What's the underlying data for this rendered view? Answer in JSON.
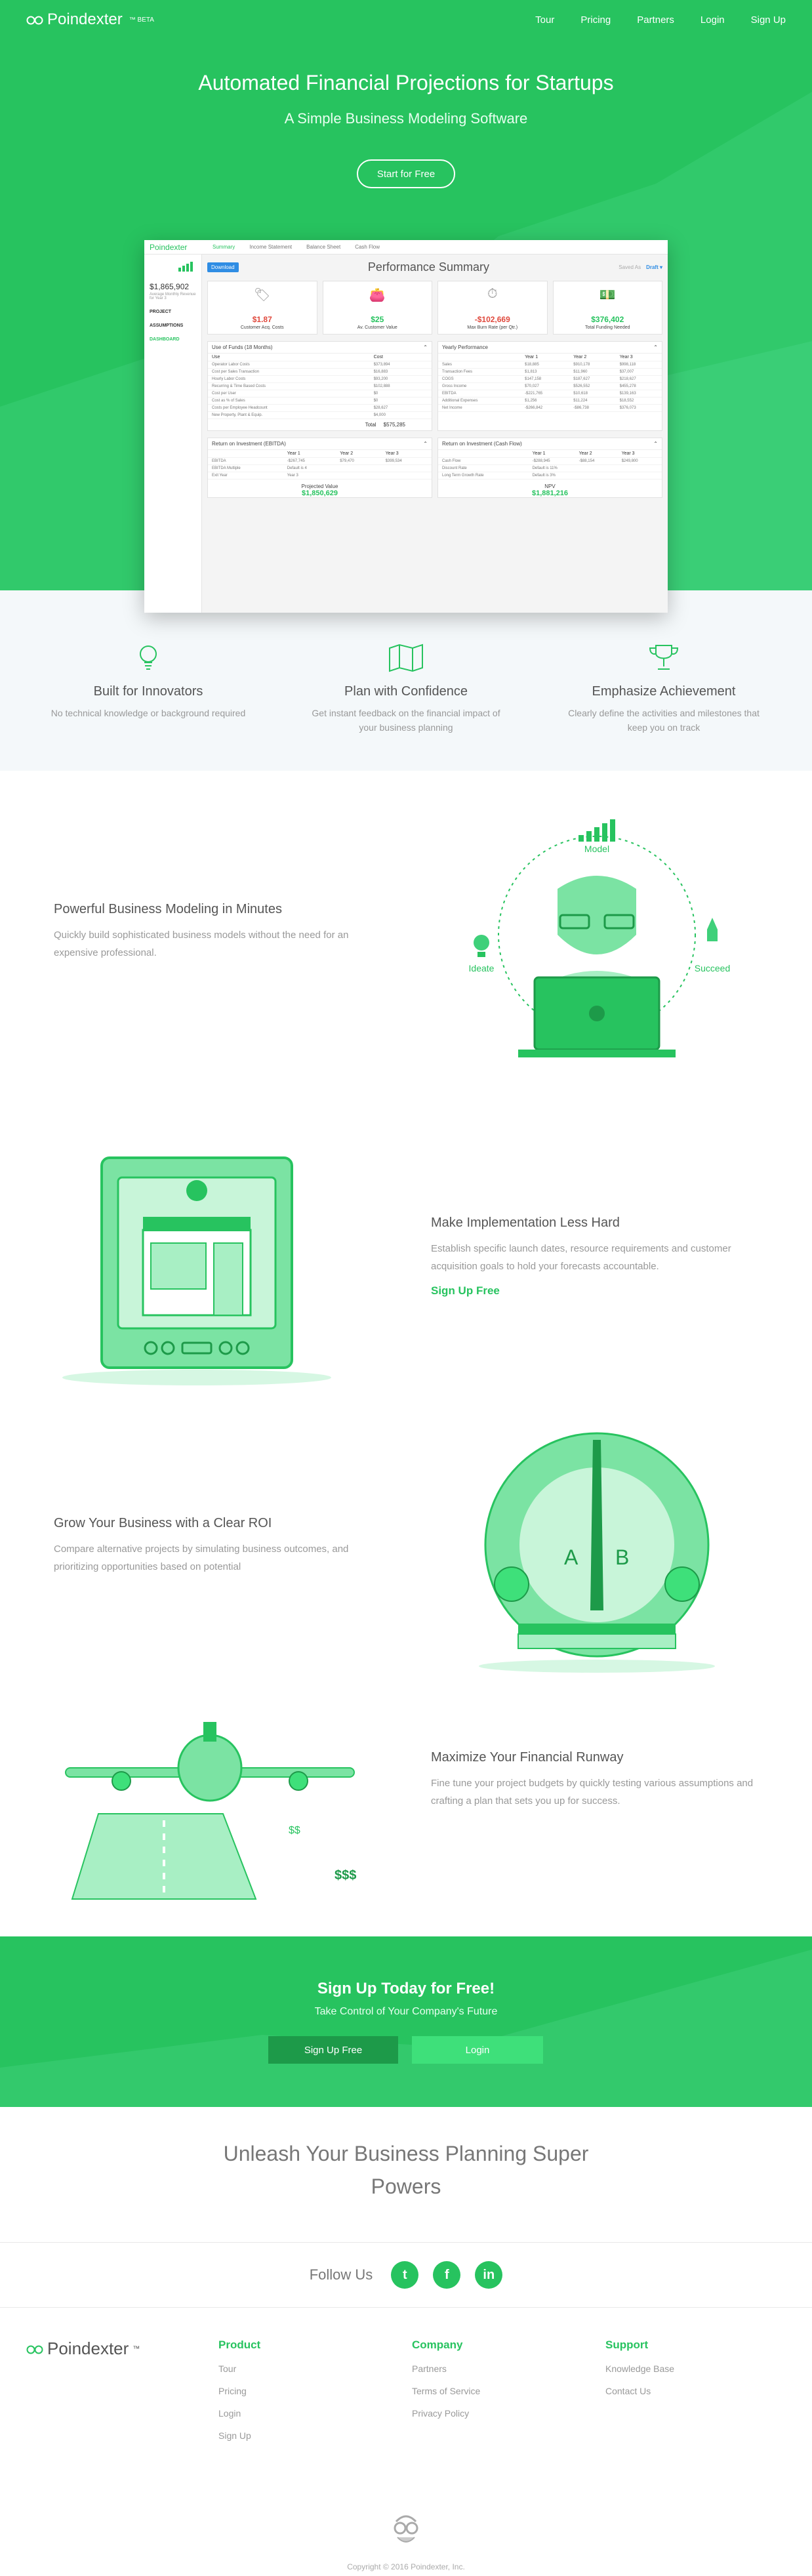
{
  "nav": {
    "brand": "Poindexter",
    "brand_tag": "™ BETA",
    "links": [
      "Tour",
      "Pricing",
      "Partners",
      "Login",
      "Sign Up"
    ]
  },
  "hero": {
    "title": "Automated Financial Projections for Startups",
    "subtitle": "A Simple Business Modeling Software",
    "cta": "Start for Free"
  },
  "app": {
    "logo": "Poindexter",
    "tabs": [
      "Summary",
      "Income Statement",
      "Balance Sheet",
      "Cash Flow"
    ],
    "side_value": "$1,865,902",
    "side_caption": "Average Monthly Revenue for Year 3",
    "side_links": [
      "PROJECT",
      "ASSUMPTIONS",
      "DASHBOARD"
    ],
    "download": "Download",
    "page_title": "Performance Summary",
    "saved_as": "Saved As",
    "draft": "Draft ▾",
    "cards": [
      {
        "value": "$1.87",
        "label": "Customer Acq. Costs",
        "color": "#e0493d",
        "icon": "tag-icon",
        "glyph": "🏷"
      },
      {
        "value": "$25",
        "label": "Av. Customer Value",
        "color": "#27c35f",
        "icon": "wallet-icon",
        "glyph": "👛"
      },
      {
        "value": "-$102,669",
        "label": "Max Burn Rate (per Qtr.)",
        "color": "#e0493d",
        "icon": "stopwatch-icon",
        "glyph": "⏱"
      },
      {
        "value": "$376,402",
        "label": "Total Funding Needed",
        "color": "#27c35f",
        "icon": "money-icon",
        "glyph": "💵"
      }
    ],
    "funds": {
      "title": "Use of Funds (18 Months)",
      "headers": [
        "Use",
        "Cost"
      ],
      "rows": [
        [
          "Operator Labor Costs",
          "$373,894"
        ],
        [
          "Cost per Sales Transaction",
          "$16,883"
        ],
        [
          "Hourly Labor Costs",
          "$93,200"
        ],
        [
          "Recurring & Time Based Costs",
          "$102,888"
        ],
        [
          "Cost per User",
          "$0"
        ],
        [
          "Cost as % of Sales",
          "$0"
        ],
        [
          "Costs per Employee Headcount",
          "$28,627"
        ],
        [
          "New Property, Plant & Equip.",
          "$4,000"
        ]
      ],
      "total_label": "Total",
      "total_value": "$575,285"
    },
    "yearly": {
      "title": "Yearly Performance",
      "headers": [
        "",
        "Year 1",
        "Year 2",
        "Year 3"
      ],
      "rows": [
        [
          "Sales",
          "$18,885",
          "$910,178",
          "$998,118"
        ],
        [
          "Transaction Fees",
          "$1,813",
          "$11,960",
          "$37,007"
        ],
        [
          "COGS",
          "$147,158",
          "$187,627",
          "$218,627"
        ],
        [
          "Gross Income",
          "$70,027",
          "$526,552",
          "$455,278"
        ],
        [
          "EBITDA",
          "-$221,765",
          "$10,618",
          "$139,163"
        ],
        [
          "Additional Expenses",
          "$1,256",
          "$11,224",
          "$18,552"
        ],
        [
          "Net Income",
          "-$266,842",
          "-$86,738",
          "$376,073"
        ]
      ]
    },
    "roi_ebitda": {
      "title": "Return on Investment (EBITDA)",
      "headers": [
        "",
        "Year 1",
        "Year 2",
        "Year 3"
      ],
      "row": [
        "EBITDA",
        "-$267,745",
        "$79,470",
        "$399,534"
      ],
      "multiple_label": "EBITDA Multiple",
      "multiple_value": "Default is 4",
      "exit_label": "Exit Year",
      "exit_value": "Year 3",
      "result_label": "Projected Value",
      "result_value": "$1,850,629"
    },
    "roi_cash": {
      "title": "Return on Investment (Cash Flow)",
      "headers": [
        "",
        "Year 1",
        "Year 2",
        "Year 3"
      ],
      "row": [
        "Cash Flow",
        "-$288,945",
        "-$88,154",
        "$249,800"
      ],
      "discount_label": "Discount Rate",
      "discount_value": "Default is 11%",
      "growth_label": "Long Term Growth Rate",
      "growth_value": "Default is 3%",
      "result_label": "NPV",
      "result_value": "$1,881,216"
    }
  },
  "features": [
    {
      "title": "Built for Innovators",
      "text": "No technical knowledge or background required",
      "icon": "lightbulb-icon"
    },
    {
      "title": "Plan with Confidence",
      "text": "Get instant feedback on the financial impact of your business planning",
      "icon": "map-icon"
    },
    {
      "title": "Emphasize Achievement",
      "text": "Clearly define the activities and milestones that keep you on track",
      "icon": "trophy-icon"
    }
  ],
  "rows": [
    {
      "title": "Powerful Business Modeling in Minutes",
      "text": "Quickly build sophisticated business models without the need for an expensive professional.",
      "illustration": {
        "model": "Model",
        "ideate": "Ideate",
        "succeed": "Succeed"
      }
    },
    {
      "title": "Make Implementation Less Hard",
      "text": "Establish specific launch dates, resource requirements and customer acquisition goals to hold your forecasts accountable.",
      "link": "Sign Up Free"
    },
    {
      "title": "Grow Your Business with a Clear ROI",
      "text": "Compare alternative projects by simulating business outcomes, and prioritizing opportunities based on potential",
      "illustration": {
        "a": "A",
        "b": "B"
      }
    },
    {
      "title": "Maximize Your Financial Runway",
      "text": "Fine tune your project budgets by quickly testing various assumptions and crafting a plan that sets you up for success.",
      "illustration": {
        "s1": "$$",
        "s2": "$$$"
      }
    }
  ],
  "band": {
    "title": "Sign Up Today for Free!",
    "subtitle": "Take Control of Your Company's Future",
    "signup": "Sign Up Free",
    "login": "Login"
  },
  "unleash": "Unleash Your Business Planning Super Powers",
  "follow": {
    "label": "Follow Us",
    "icons": [
      "twitter-icon",
      "facebook-icon",
      "linkedin-icon"
    ]
  },
  "footer": {
    "brand": "Poindexter",
    "brand_tm": "™",
    "columns": [
      {
        "title": "Product",
        "links": [
          "Tour",
          "Pricing",
          "Login",
          "Sign Up"
        ]
      },
      {
        "title": "Company",
        "links": [
          "Partners",
          "Terms of Service",
          "Privacy Policy"
        ]
      },
      {
        "title": "Support",
        "links": [
          "Knowledge Base",
          "Contact Us"
        ]
      }
    ],
    "copyright": "Copyright © 2016 Poindexter, Inc."
  },
  "colors": {
    "brand_green": "#27c35f",
    "dark_green": "#1d9a49",
    "light_green": "#3ee07a",
    "red": "#e0493d",
    "blue": "#2f8de4"
  }
}
